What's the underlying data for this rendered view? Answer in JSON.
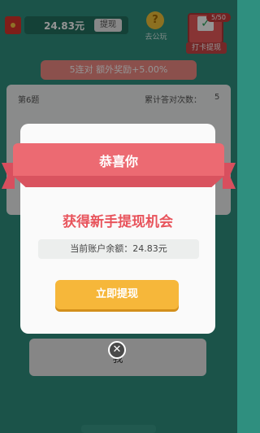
{
  "header": {
    "balance": "24.83元",
    "withdraw_label": "提现",
    "ad_icon_glyph": "?",
    "ad_label": "去公玩",
    "checkin_progress": "5/50",
    "checkin_label": "打卡提现"
  },
  "streak_banner": "5连对 额外奖励+5.00%",
  "question": {
    "number_label": "第6题",
    "correct_count_label": "累计答对次数：",
    "correct_count_value": "5"
  },
  "background_answer": "我",
  "modal": {
    "title": "恭喜你",
    "headline": "获得新手提现机会",
    "balance_line": "当前账户余额：24.83元",
    "cta_label": "立即提现",
    "close_glyph": "✕"
  },
  "colors": {
    "background": "#2f8f7f",
    "ribbon": "#ec6a72",
    "headline": "#e8545c",
    "cta": "#f6b73a"
  }
}
